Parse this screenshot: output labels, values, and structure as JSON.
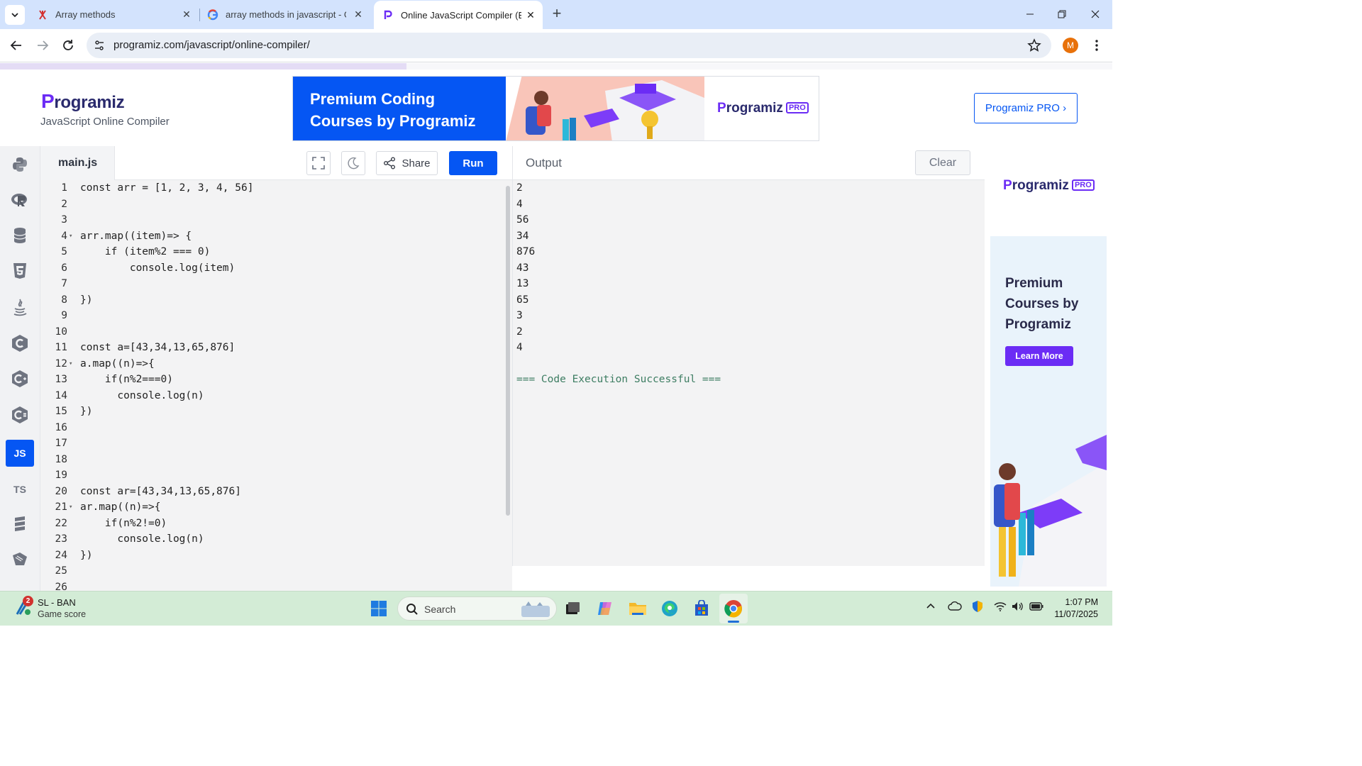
{
  "browser": {
    "tabs": [
      {
        "title": "Array methods",
        "active": false
      },
      {
        "title": "array methods in javascript - Go",
        "active": false
      },
      {
        "title": "Online JavaScript Compiler (Edi",
        "active": true
      }
    ],
    "url": "programiz.com/javascript/online-compiler/",
    "profile_initial": "M"
  },
  "header": {
    "logo": "rogramiz",
    "logo_p": "P",
    "subtitle": "JavaScript Online Compiler",
    "pro_button": "Programiz PRO ›"
  },
  "banner": {
    "headline_1": "Premium Coding",
    "headline_2": "Courses by Programiz",
    "logo": "rogramiz",
    "logo_p": "P",
    "badge": "PRO"
  },
  "sidebar": {
    "languages": [
      {
        "name": "python-icon",
        "label": ""
      },
      {
        "name": "r-icon",
        "label": ""
      },
      {
        "name": "sql-icon",
        "label": ""
      },
      {
        "name": "html-icon",
        "label": ""
      },
      {
        "name": "java-icon",
        "label": ""
      },
      {
        "name": "c-icon",
        "label": ""
      },
      {
        "name": "cpp-icon",
        "label": ""
      },
      {
        "name": "csharp-icon",
        "label": ""
      },
      {
        "name": "js-icon",
        "label": "JS",
        "active": true
      },
      {
        "name": "ts-icon",
        "label": "TS"
      },
      {
        "name": "go-icon",
        "label": ""
      },
      {
        "name": "swift-icon",
        "label": ""
      }
    ]
  },
  "editor": {
    "filename": "main.js",
    "share_label": "Share",
    "run_label": "Run",
    "lines": [
      {
        "n": "1",
        "text": "const arr = [1, 2, 3, 4, 56]",
        "fold": ""
      },
      {
        "n": "2",
        "text": "",
        "fold": ""
      },
      {
        "n": "3",
        "text": "",
        "fold": ""
      },
      {
        "n": "4",
        "text": "arr.map((item)=> {",
        "fold": "▾"
      },
      {
        "n": "5",
        "text": "    if (item%2 === 0)",
        "fold": ""
      },
      {
        "n": "6",
        "text": "        console.log(item)",
        "fold": ""
      },
      {
        "n": "7",
        "text": "",
        "fold": ""
      },
      {
        "n": "8",
        "text": "})",
        "fold": ""
      },
      {
        "n": "9",
        "text": "",
        "fold": ""
      },
      {
        "n": "10",
        "text": "",
        "fold": ""
      },
      {
        "n": "11",
        "text": "const a=[43,34,13,65,876]",
        "fold": ""
      },
      {
        "n": "12",
        "text": "a.map((n)=>{",
        "fold": "▾"
      },
      {
        "n": "13",
        "text": "    if(n%2===0)",
        "fold": ""
      },
      {
        "n": "14",
        "text": "      console.log(n)",
        "fold": ""
      },
      {
        "n": "15",
        "text": "})",
        "fold": ""
      },
      {
        "n": "16",
        "text": "",
        "fold": ""
      },
      {
        "n": "17",
        "text": "",
        "fold": ""
      },
      {
        "n": "18",
        "text": "",
        "fold": ""
      },
      {
        "n": "19",
        "text": "",
        "fold": ""
      },
      {
        "n": "20",
        "text": "const ar=[43,34,13,65,876]",
        "fold": ""
      },
      {
        "n": "21",
        "text": "ar.map((n)=>{",
        "fold": "▾"
      },
      {
        "n": "22",
        "text": "    if(n%2!=0)",
        "fold": ""
      },
      {
        "n": "23",
        "text": "      console.log(n)",
        "fold": ""
      },
      {
        "n": "24",
        "text": "})",
        "fold": ""
      },
      {
        "n": "25",
        "text": "",
        "fold": ""
      },
      {
        "n": "26",
        "text": "",
        "fold": ""
      }
    ]
  },
  "output": {
    "title": "Output",
    "clear_label": "Clear",
    "lines": [
      "2",
      "4",
      "56",
      "34",
      "876",
      "43",
      "13",
      "65",
      "3",
      "2",
      "4",
      "",
      "=== Code Execution Successful ==="
    ]
  },
  "right_ad": {
    "logo": "rogramiz",
    "logo_p": "P",
    "badge": "PRO",
    "headline": [
      "Premium",
      "Courses by",
      "Programiz"
    ],
    "button": "Learn More"
  },
  "taskbar": {
    "game_title": "SL - BAN",
    "game_sub": "Game score",
    "badge": "2",
    "search_label": "Search",
    "time": "1:07 PM",
    "date": "11/07/2025"
  }
}
